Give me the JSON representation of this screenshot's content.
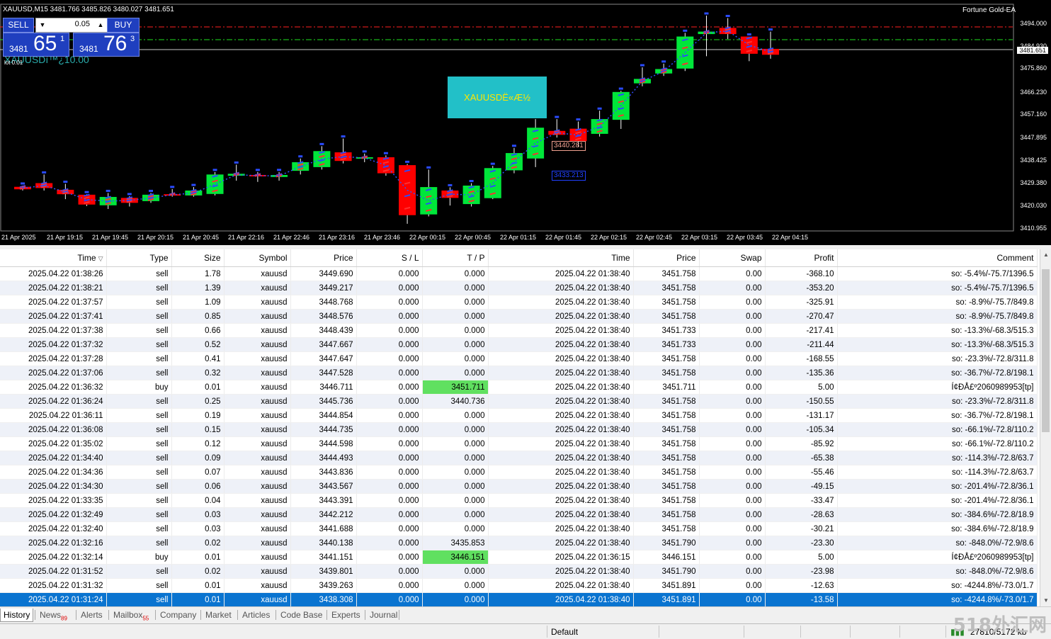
{
  "chart": {
    "title": "XAUUSD,M15  3481.766 3485.826 3480.027 3481.651",
    "ea_name": "Fortune Gold-EA",
    "current_price_tag": "3481.651",
    "overlay_text": "XAUUSDË«Æ½",
    "ghost_text": "XAUUSDì™¿10.00",
    "ghost_text2": "lot 0.01",
    "annotation_1": "3440.281",
    "annotation_2": "3433.213",
    "one_click": {
      "sell_label": "SELL",
      "buy_label": "BUY",
      "lot": "0.05",
      "bid_small": "3481",
      "bid_big": "65",
      "bid_sup": "1",
      "ask_small": "3481",
      "ask_big": "76",
      "ask_sup": "3"
    },
    "y_ticks": [
      "3494.000",
      "3484.930",
      "3475.860",
      "3466.230",
      "3457.160",
      "3447.895",
      "3438.425",
      "3429.380",
      "3420.030",
      "3410.955"
    ],
    "x_ticks": [
      "21 Apr 2025",
      "21 Apr 19:15",
      "21 Apr 19:45",
      "21 Apr 20:15",
      "21 Apr 20:45",
      "21 Apr 22:16",
      "21 Apr 22:46",
      "21 Apr 23:16",
      "21 Apr 23:46",
      "22 Apr 00:15",
      "22 Apr 00:45",
      "22 Apr 01:15",
      "22 Apr 01:45",
      "22 Apr 02:15",
      "22 Apr 02:45",
      "22 Apr 03:15",
      "22 Apr 03:45",
      "22 Apr 04:15"
    ],
    "colors": {
      "bull": "#00e63a",
      "bear": "#ff0000",
      "background": "#000000"
    },
    "candles": [
      {
        "o": 3428.0,
        "c": 3427.0,
        "h": 3428.5,
        "l": 3426.5
      },
      {
        "o": 3429.5,
        "c": 3427.5,
        "h": 3433.0,
        "l": 3426.5
      },
      {
        "o": 3426.8,
        "c": 3425.0,
        "h": 3429.2,
        "l": 3423.0
      },
      {
        "o": 3424.8,
        "c": 3420.8,
        "h": 3425.0,
        "l": 3420.2
      },
      {
        "o": 3420.5,
        "c": 3423.9,
        "h": 3425.5,
        "l": 3419.0
      },
      {
        "o": 3423.5,
        "c": 3421.5,
        "h": 3424.2,
        "l": 3420.0
      },
      {
        "o": 3422.2,
        "c": 3424.8,
        "h": 3425.5,
        "l": 3421.5
      },
      {
        "o": 3425.0,
        "c": 3424.5,
        "h": 3427.1,
        "l": 3424.0
      },
      {
        "o": 3424.5,
        "c": 3426.5,
        "h": 3427.9,
        "l": 3424.0
      },
      {
        "o": 3425.1,
        "c": 3433.0,
        "h": 3434.0,
        "l": 3424.5
      },
      {
        "o": 3432.5,
        "c": 3433.3,
        "h": 3437.0,
        "l": 3430.5
      },
      {
        "o": 3432.8,
        "c": 3432.3,
        "h": 3434.0,
        "l": 3430.0
      },
      {
        "o": 3432.0,
        "c": 3432.8,
        "h": 3434.0,
        "l": 3430.5
      },
      {
        "o": 3434.5,
        "c": 3438.0,
        "h": 3439.5,
        "l": 3433.0
      },
      {
        "o": 3436.0,
        "c": 3442.5,
        "h": 3444.5,
        "l": 3435.0
      },
      {
        "o": 3442.0,
        "c": 3438.5,
        "h": 3447.6,
        "l": 3437.5
      },
      {
        "o": 3439.5,
        "c": 3440.0,
        "h": 3441.5,
        "l": 3438.0
      },
      {
        "o": 3440.0,
        "c": 3433.5,
        "h": 3440.8,
        "l": 3432.5
      },
      {
        "o": 3436.8,
        "c": 3416.5,
        "h": 3437.3,
        "l": 3413.0
      },
      {
        "o": 3416.8,
        "c": 3427.9,
        "h": 3435.0,
        "l": 3416.0
      },
      {
        "o": 3426.5,
        "c": 3423.5,
        "h": 3427.8,
        "l": 3420.4
      },
      {
        "o": 3421.0,
        "c": 3428.5,
        "h": 3429.5,
        "l": 3420.0
      },
      {
        "o": 3423.4,
        "c": 3435.6,
        "h": 3436.5,
        "l": 3423.0
      },
      {
        "o": 3434.7,
        "c": 3441.7,
        "h": 3443.8,
        "l": 3433.5
      },
      {
        "o": 3439.5,
        "c": 3452.0,
        "h": 3455.5,
        "l": 3436.0
      },
      {
        "o": 3450.7,
        "c": 3449.1,
        "h": 3455.5,
        "l": 3448.0
      },
      {
        "o": 3451.6,
        "c": 3446.5,
        "h": 3454.5,
        "l": 3444.2
      },
      {
        "o": 3449.5,
        "c": 3455.5,
        "h": 3458.9,
        "l": 3448.4
      },
      {
        "o": 3455.2,
        "c": 3466.5,
        "h": 3467.0,
        "l": 3451.5
      },
      {
        "o": 3470.0,
        "c": 3471.8,
        "h": 3476.5,
        "l": 3468.8
      },
      {
        "o": 3474.0,
        "c": 3475.8,
        "h": 3478.0,
        "l": 3473.0
      },
      {
        "o": 3476.0,
        "c": 3489.0,
        "h": 3490.5,
        "l": 3475.0
      },
      {
        "o": 3490.0,
        "c": 3491.0,
        "h": 3497.5,
        "l": 3481.0
      },
      {
        "o": 3492.5,
        "c": 3490.0,
        "h": 3496.5,
        "l": 3488.0
      },
      {
        "o": 3489.0,
        "c": 3482.0,
        "h": 3489.0,
        "l": 3479.0
      },
      {
        "o": 3484.0,
        "c": 3481.6,
        "h": 3491.0,
        "l": 3480.0
      }
    ]
  },
  "table": {
    "columns": [
      "Time",
      "Type",
      "Size",
      "Symbol",
      "Price",
      "S / L",
      "T / P",
      "Time",
      "Price",
      "Swap",
      "Profit",
      "Comment"
    ],
    "rows": [
      [
        "2025.04.22 01:38:26",
        "sell",
        "1.78",
        "xauusd",
        "3449.690",
        "0.000",
        "0.000",
        "2025.04.22 01:38:40",
        "3451.758",
        "0.00",
        "-368.10",
        "so: -5.4%/-75.7/1396.5"
      ],
      [
        "2025.04.22 01:38:21",
        "sell",
        "1.39",
        "xauusd",
        "3449.217",
        "0.000",
        "0.000",
        "2025.04.22 01:38:40",
        "3451.758",
        "0.00",
        "-353.20",
        "so: -5.4%/-75.7/1396.5"
      ],
      [
        "2025.04.22 01:37:57",
        "sell",
        "1.09",
        "xauusd",
        "3448.768",
        "0.000",
        "0.000",
        "2025.04.22 01:38:40",
        "3451.758",
        "0.00",
        "-325.91",
        "so: -8.9%/-75.7/849.8"
      ],
      [
        "2025.04.22 01:37:41",
        "sell",
        "0.85",
        "xauusd",
        "3448.576",
        "0.000",
        "0.000",
        "2025.04.22 01:38:40",
        "3451.758",
        "0.00",
        "-270.47",
        "so: -8.9%/-75.7/849.8"
      ],
      [
        "2025.04.22 01:37:38",
        "sell",
        "0.66",
        "xauusd",
        "3448.439",
        "0.000",
        "0.000",
        "2025.04.22 01:38:40",
        "3451.733",
        "0.00",
        "-217.41",
        "so: -13.3%/-68.3/515.3"
      ],
      [
        "2025.04.22 01:37:32",
        "sell",
        "0.52",
        "xauusd",
        "3447.667",
        "0.000",
        "0.000",
        "2025.04.22 01:38:40",
        "3451.733",
        "0.00",
        "-211.44",
        "so: -13.3%/-68.3/515.3"
      ],
      [
        "2025.04.22 01:37:28",
        "sell",
        "0.41",
        "xauusd",
        "3447.647",
        "0.000",
        "0.000",
        "2025.04.22 01:38:40",
        "3451.758",
        "0.00",
        "-168.55",
        "so: -23.3%/-72.8/311.8"
      ],
      [
        "2025.04.22 01:37:06",
        "sell",
        "0.32",
        "xauusd",
        "3447.528",
        "0.000",
        "0.000",
        "2025.04.22 01:38:40",
        "3451.758",
        "0.00",
        "-135.36",
        "so: -36.7%/-72.8/198.1"
      ],
      [
        "2025.04.22 01:36:32",
        "buy",
        "0.01",
        "xauusd",
        "3446.711",
        "0.000",
        "3451.711",
        "2025.04.22 01:38:40",
        "3451.711",
        "0.00",
        "5.00",
        "Í¢ÐÅ£º2060989953[tp]"
      ],
      [
        "2025.04.22 01:36:24",
        "sell",
        "0.25",
        "xauusd",
        "3445.736",
        "0.000",
        "3440.736",
        "2025.04.22 01:38:40",
        "3451.758",
        "0.00",
        "-150.55",
        "so: -23.3%/-72.8/311.8"
      ],
      [
        "2025.04.22 01:36:11",
        "sell",
        "0.19",
        "xauusd",
        "3444.854",
        "0.000",
        "0.000",
        "2025.04.22 01:38:40",
        "3451.758",
        "0.00",
        "-131.17",
        "so: -36.7%/-72.8/198.1"
      ],
      [
        "2025.04.22 01:36:08",
        "sell",
        "0.15",
        "xauusd",
        "3444.735",
        "0.000",
        "0.000",
        "2025.04.22 01:38:40",
        "3451.758",
        "0.00",
        "-105.34",
        "so: -66.1%/-72.8/110.2"
      ],
      [
        "2025.04.22 01:35:02",
        "sell",
        "0.12",
        "xauusd",
        "3444.598",
        "0.000",
        "0.000",
        "2025.04.22 01:38:40",
        "3451.758",
        "0.00",
        "-85.92",
        "so: -66.1%/-72.8/110.2"
      ],
      [
        "2025.04.22 01:34:40",
        "sell",
        "0.09",
        "xauusd",
        "3444.493",
        "0.000",
        "0.000",
        "2025.04.22 01:38:40",
        "3451.758",
        "0.00",
        "-65.38",
        "so: -114.3%/-72.8/63.7"
      ],
      [
        "2025.04.22 01:34:36",
        "sell",
        "0.07",
        "xauusd",
        "3443.836",
        "0.000",
        "0.000",
        "2025.04.22 01:38:40",
        "3451.758",
        "0.00",
        "-55.46",
        "so: -114.3%/-72.8/63.7"
      ],
      [
        "2025.04.22 01:34:30",
        "sell",
        "0.06",
        "xauusd",
        "3443.567",
        "0.000",
        "0.000",
        "2025.04.22 01:38:40",
        "3451.758",
        "0.00",
        "-49.15",
        "so: -201.4%/-72.8/36.1"
      ],
      [
        "2025.04.22 01:33:35",
        "sell",
        "0.04",
        "xauusd",
        "3443.391",
        "0.000",
        "0.000",
        "2025.04.22 01:38:40",
        "3451.758",
        "0.00",
        "-33.47",
        "so: -201.4%/-72.8/36.1"
      ],
      [
        "2025.04.22 01:32:49",
        "sell",
        "0.03",
        "xauusd",
        "3442.212",
        "0.000",
        "0.000",
        "2025.04.22 01:38:40",
        "3451.758",
        "0.00",
        "-28.63",
        "so: -384.6%/-72.8/18.9"
      ],
      [
        "2025.04.22 01:32:40",
        "sell",
        "0.03",
        "xauusd",
        "3441.688",
        "0.000",
        "0.000",
        "2025.04.22 01:38:40",
        "3451.758",
        "0.00",
        "-30.21",
        "so: -384.6%/-72.8/18.9"
      ],
      [
        "2025.04.22 01:32:16",
        "sell",
        "0.02",
        "xauusd",
        "3440.138",
        "0.000",
        "3435.853",
        "2025.04.22 01:38:40",
        "3451.790",
        "0.00",
        "-23.30",
        "so: -848.0%/-72.9/8.6"
      ],
      [
        "2025.04.22 01:32:14",
        "buy",
        "0.01",
        "xauusd",
        "3441.151",
        "0.000",
        "3446.151",
        "2025.04.22 01:36:15",
        "3446.151",
        "0.00",
        "5.00",
        "Í¢ÐÅ£º2060989953[tp]"
      ],
      [
        "2025.04.22 01:31:52",
        "sell",
        "0.02",
        "xauusd",
        "3439.801",
        "0.000",
        "0.000",
        "2025.04.22 01:38:40",
        "3451.790",
        "0.00",
        "-23.98",
        "so: -848.0%/-72.9/8.6"
      ],
      [
        "2025.04.22 01:31:32",
        "sell",
        "0.01",
        "xauusd",
        "3439.263",
        "0.000",
        "0.000",
        "2025.04.22 01:38:40",
        "3451.891",
        "0.00",
        "-12.63",
        "so: -4244.8%/-73.0/1.7"
      ],
      [
        "2025.04.22 01:31:24",
        "sell",
        "0.01",
        "xauusd",
        "3438.308",
        "0.000",
        "0.000",
        "2025.04.22 01:38:40",
        "3451.891",
        "0.00",
        "-13.58",
        "so: -4244.8%/-73.0/1.7"
      ]
    ],
    "tp_highlight_rows": [
      8,
      20
    ],
    "selected_row": 23
  },
  "tabs": [
    {
      "label": "History",
      "badge": ""
    },
    {
      "label": "News",
      "badge": "89"
    },
    {
      "label": "Alerts",
      "badge": ""
    },
    {
      "label": "Mailbox",
      "badge": "55"
    },
    {
      "label": "Company",
      "badge": ""
    },
    {
      "label": "Market",
      "badge": ""
    },
    {
      "label": "Articles",
      "badge": ""
    },
    {
      "label": "Code Base",
      "badge": ""
    },
    {
      "label": "Experts",
      "badge": ""
    },
    {
      "label": "Journal",
      "badge": ""
    }
  ],
  "status": {
    "profile": "Default",
    "traffic": "27810/5172 kb"
  },
  "watermark": "518外汇网"
}
